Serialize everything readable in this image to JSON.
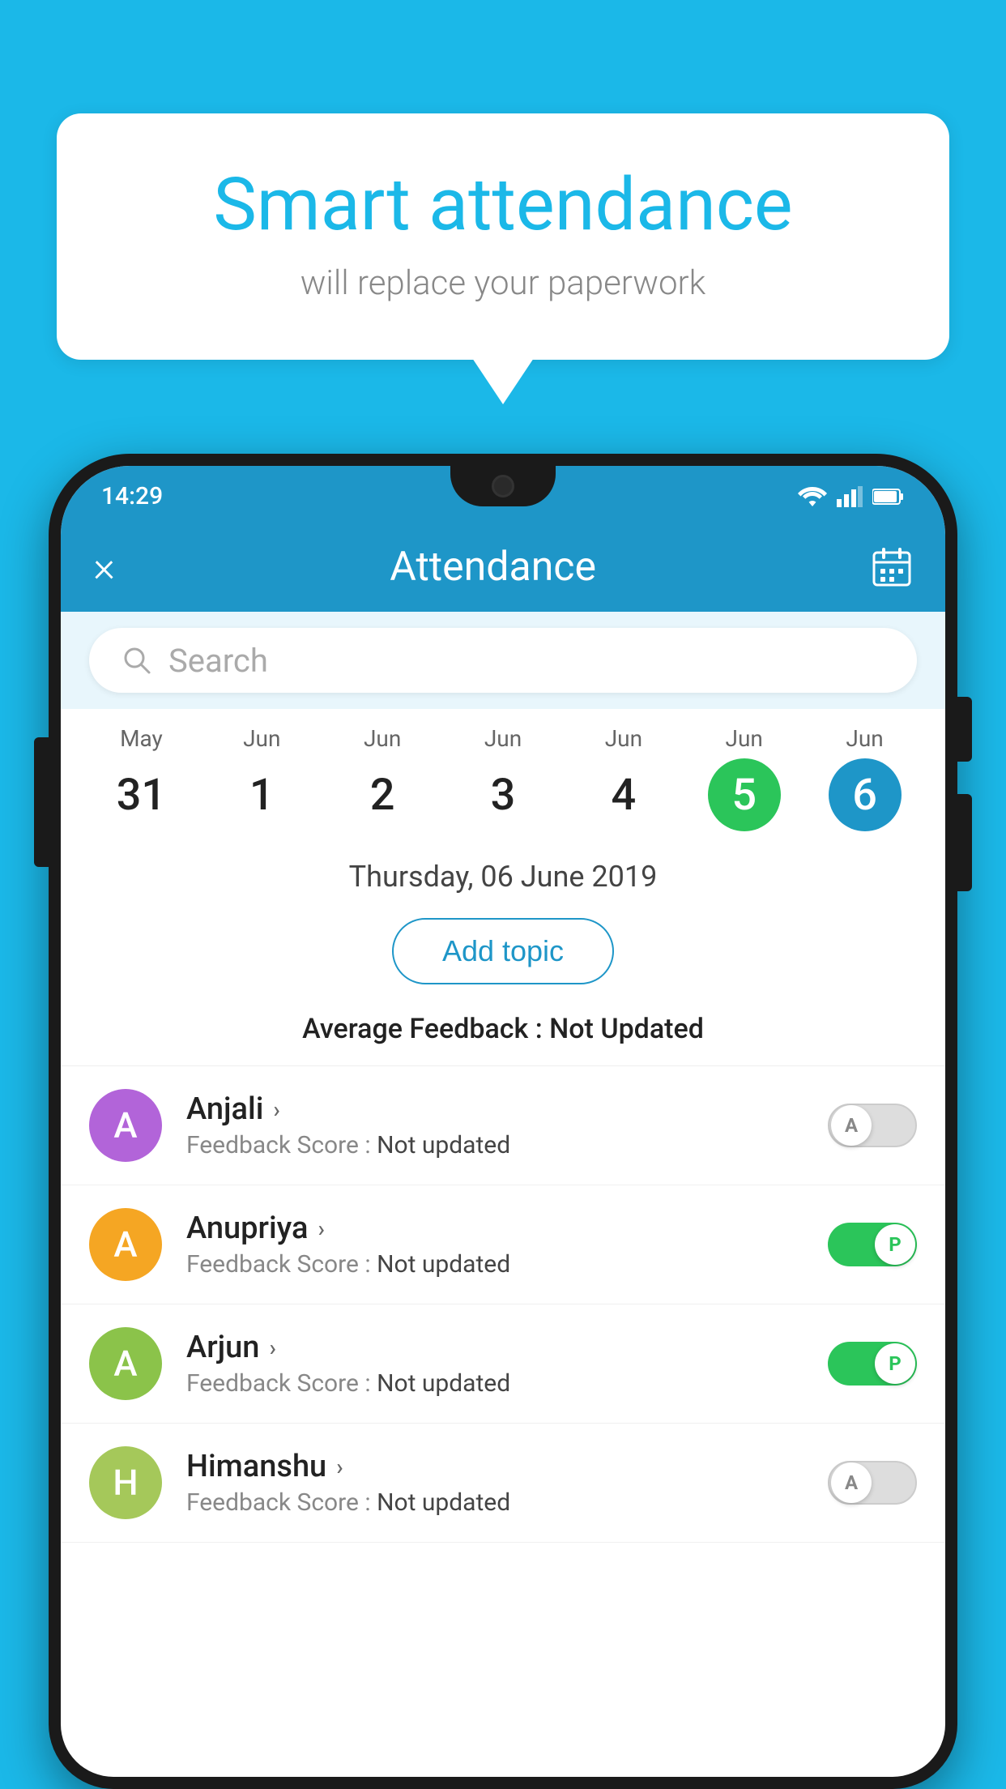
{
  "background_color": "#1bb8e8",
  "bubble": {
    "title": "Smart attendance",
    "subtitle": "will replace your paperwork"
  },
  "phone": {
    "status_bar": {
      "time": "14:29"
    },
    "app_bar": {
      "title": "Attendance",
      "close_icon": "×",
      "calendar_icon": "📅"
    },
    "search": {
      "placeholder": "Search"
    },
    "date_strip": [
      {
        "month": "May",
        "day": "31",
        "state": "normal"
      },
      {
        "month": "Jun",
        "day": "1",
        "state": "normal"
      },
      {
        "month": "Jun",
        "day": "2",
        "state": "normal"
      },
      {
        "month": "Jun",
        "day": "3",
        "state": "normal"
      },
      {
        "month": "Jun",
        "day": "4",
        "state": "normal"
      },
      {
        "month": "Jun",
        "day": "5",
        "state": "today"
      },
      {
        "month": "Jun",
        "day": "6",
        "state": "selected"
      }
    ],
    "selected_date": "Thursday, 06 June 2019",
    "add_topic_label": "Add topic",
    "average_feedback_label": "Average Feedback : ",
    "average_feedback_value": "Not Updated",
    "students": [
      {
        "name": "Anjali",
        "avatar_letter": "A",
        "avatar_color": "#b264d9",
        "feedback_label": "Feedback Score : ",
        "feedback_value": "Not updated",
        "toggle_state": "off",
        "toggle_label": "A"
      },
      {
        "name": "Anupriya",
        "avatar_letter": "A",
        "avatar_color": "#f5a623",
        "feedback_label": "Feedback Score : ",
        "feedback_value": "Not updated",
        "toggle_state": "on",
        "toggle_label": "P"
      },
      {
        "name": "Arjun",
        "avatar_letter": "A",
        "avatar_color": "#8bc34a",
        "feedback_label": "Feedback Score : ",
        "feedback_value": "Not updated",
        "toggle_state": "on",
        "toggle_label": "P"
      },
      {
        "name": "Himanshu",
        "avatar_letter": "H",
        "avatar_color": "#a5c85a",
        "feedback_label": "Feedback Score : ",
        "feedback_value": "Not updated",
        "toggle_state": "off",
        "toggle_label": "A"
      }
    ]
  }
}
